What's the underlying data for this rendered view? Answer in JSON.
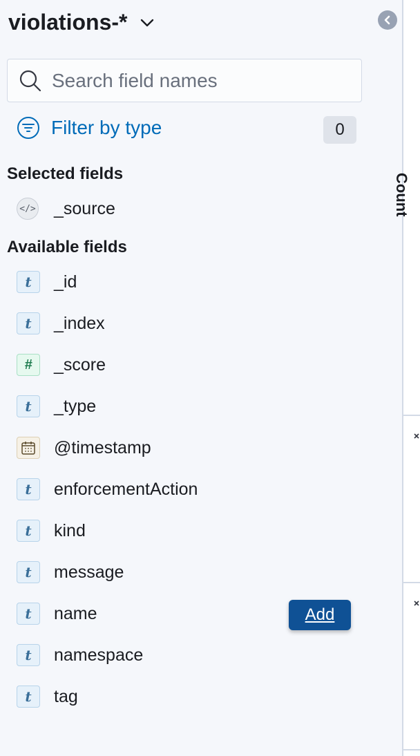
{
  "index_pattern": {
    "title": "violations-*"
  },
  "search": {
    "placeholder": "Search field names",
    "value": ""
  },
  "filter": {
    "label": "Filter by type",
    "count": "0"
  },
  "selected_fields": {
    "title": "Selected fields",
    "items": [
      {
        "name": "_source",
        "type": "source",
        "icon": "code-icon"
      }
    ]
  },
  "available_fields": {
    "title": "Available fields",
    "items": [
      {
        "name": "_id",
        "type": "string",
        "icon": "t"
      },
      {
        "name": "_index",
        "type": "string",
        "icon": "t"
      },
      {
        "name": "_score",
        "type": "number",
        "icon": "#"
      },
      {
        "name": "_type",
        "type": "string",
        "icon": "t"
      },
      {
        "name": "@timestamp",
        "type": "date",
        "icon": "calendar-icon"
      },
      {
        "name": "enforcementAction",
        "type": "string",
        "icon": "t"
      },
      {
        "name": "kind",
        "type": "string",
        "icon": "t"
      },
      {
        "name": "message",
        "type": "string",
        "icon": "t"
      },
      {
        "name": "name",
        "type": "string",
        "icon": "t"
      },
      {
        "name": "namespace",
        "type": "string",
        "icon": "t"
      },
      {
        "name": "tag",
        "type": "string",
        "icon": "t"
      }
    ]
  },
  "hover_action": {
    "label": "Add"
  },
  "right_panel": {
    "axis_label": "Count"
  },
  "colors": {
    "sidebar_bg": "#f5f7fb",
    "link": "#006bb8",
    "add_button": "#0f5195",
    "badge": "#dfe3ea"
  }
}
